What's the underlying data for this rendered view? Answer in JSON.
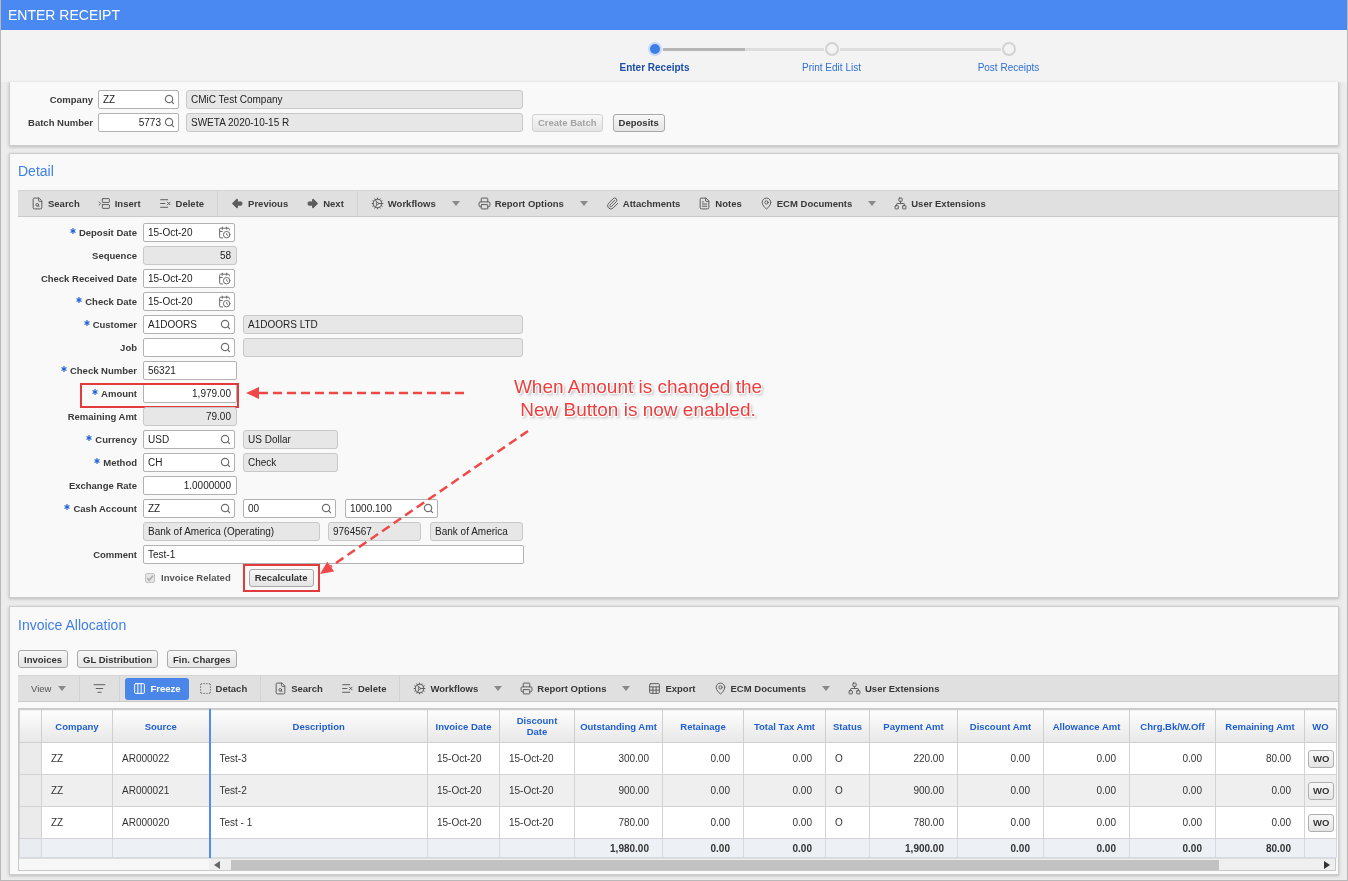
{
  "window": {
    "title": "ENTER RECEIPT"
  },
  "steps": [
    {
      "label": "Enter Receipts",
      "selected": true
    },
    {
      "label": "Print Edit List",
      "selected": false
    },
    {
      "label": "Post Receipts",
      "selected": false
    }
  ],
  "header": {
    "fields": [
      {
        "label": "Company",
        "kind": "code",
        "value": "ZZ",
        "description": "CMiC Test Company"
      },
      {
        "label": "Batch Number",
        "kind": "number",
        "value": "5773",
        "description": "SWETA 2020-10-15 R"
      }
    ],
    "buttons": [
      {
        "label": "Create Batch",
        "disabled": true
      },
      {
        "label": "Deposits",
        "disabled": false
      }
    ]
  },
  "detail": {
    "title": "Detail",
    "toolbar": [
      [
        {
          "label": "Search",
          "dropdown": false
        },
        {
          "label": "Insert",
          "dropdown": false
        },
        {
          "label": "Delete",
          "dropdown": false
        }
      ],
      [
        {
          "label": "Previous",
          "dropdown": false
        },
        {
          "label": "Next",
          "dropdown": false
        }
      ],
      [
        {
          "label": "Workflows",
          "dropdown": true
        },
        {
          "label": "Report Options",
          "dropdown": true
        },
        {
          "label": "Attachments",
          "dropdown": false
        },
        {
          "label": "Notes",
          "dropdown": false
        },
        {
          "label": "ECM Documents",
          "dropdown": true
        },
        {
          "label": "User Extensions",
          "dropdown": false
        }
      ]
    ],
    "fields": [
      {
        "label": "Deposit Date",
        "kind": "date",
        "required": true,
        "highlighted": false,
        "value": "15-Oct-20"
      },
      {
        "label": "Sequence",
        "kind": "display",
        "required": false,
        "highlighted": false,
        "value": "58"
      },
      {
        "label": "Check Received Date",
        "kind": "date",
        "required": false,
        "highlighted": false,
        "value": "15-Oct-20"
      },
      {
        "label": "Check Date",
        "kind": "date",
        "required": true,
        "highlighted": false,
        "value": "15-Oct-20"
      },
      {
        "label": "Customer",
        "kind": "lookup",
        "required": true,
        "highlighted": false,
        "value": "A1DOORS",
        "description": "A1DOORS LTD"
      },
      {
        "label": "Job",
        "kind": "lookup",
        "required": false,
        "highlighted": false
      },
      {
        "label": "Check Number",
        "kind": "text",
        "required": true,
        "highlighted": false,
        "value": "56321"
      },
      {
        "label": "Amount",
        "kind": "number",
        "required": true,
        "highlighted": true,
        "value": "1,979.00"
      },
      {
        "label": "Remaining Amt",
        "kind": "display",
        "required": false,
        "highlighted": false,
        "value": "79.00"
      },
      {
        "label": "Currency",
        "kind": "code_lookup",
        "required": true,
        "highlighted": false,
        "value": "USD",
        "description": "US Dollar"
      },
      {
        "label": "Method",
        "kind": "code_lookup",
        "required": true,
        "highlighted": false,
        "value": "CH",
        "description": "Check"
      },
      {
        "label": "Exchange Rate",
        "kind": "number",
        "required": false,
        "highlighted": false,
        "value": "1.0000000"
      },
      {
        "label": "Cash Account",
        "kind": "account",
        "required": true,
        "highlighted": false,
        "segments": [
          "ZZ",
          "00",
          "1000.100"
        ]
      },
      {
        "kind": "details",
        "required": false,
        "highlighted": false,
        "values": [
          "Bank of America (Operating)",
          "9764567",
          "Bank of America"
        ]
      },
      {
        "label": "Comment",
        "kind": "note",
        "required": false,
        "highlighted": false,
        "value": "Test-1"
      },
      {
        "label": "Invoice Related",
        "kind": "checkbox",
        "required": false,
        "highlighted": true,
        "checked": true,
        "disabled": true,
        "button": "Recalculate"
      }
    ]
  },
  "annotation": {
    "text": "When Amount is changed the New Button is now enabled."
  },
  "invoice_allocation": {
    "title": "Invoice Allocation",
    "buttons": [
      "Invoices",
      "GL Distribution",
      "Fin. Charges"
    ],
    "toolbar": [
      [
        {
          "kind": "menu",
          "label": "View",
          "dropdown": true,
          "selected": false
        }
      ],
      [
        {
          "kind": "icon",
          "dropdown": false,
          "selected": false
        }
      ],
      [
        {
          "kind": "button",
          "label": "Freeze",
          "dropdown": false,
          "selected": true
        },
        {
          "kind": "button",
          "label": "Detach",
          "dropdown": false,
          "selected": false
        }
      ],
      [
        {
          "kind": "button",
          "label": "Search",
          "dropdown": false,
          "selected": false
        },
        {
          "kind": "button",
          "label": "Delete",
          "dropdown": false,
          "selected": false
        }
      ],
      [
        {
          "kind": "button",
          "label": "Workflows",
          "dropdown": true,
          "selected": false
        },
        {
          "kind": "button",
          "label": "Report Options",
          "dropdown": true,
          "selected": false
        },
        {
          "kind": "button",
          "label": "Export",
          "dropdown": false,
          "selected": false
        },
        {
          "kind": "button",
          "label": "ECM Documents",
          "dropdown": true,
          "selected": false
        },
        {
          "kind": "button",
          "label": "User Extensions",
          "dropdown": false,
          "selected": false
        }
      ]
    ],
    "table": {
      "columns": [
        {
          "label": "Company",
          "kind": "text"
        },
        {
          "label": "Source",
          "kind": "text"
        },
        {
          "label": "Description",
          "kind": "text"
        },
        {
          "label": "Invoice Date",
          "kind": "text"
        },
        {
          "label": "Discount Date",
          "kind": "text"
        },
        {
          "label": "Outstanding Amt",
          "kind": "amount"
        },
        {
          "label": "Retainage",
          "kind": "amount"
        },
        {
          "label": "Total Tax Amt",
          "kind": "amount"
        },
        {
          "label": "Status",
          "kind": "text"
        },
        {
          "label": "Payment Amt",
          "kind": "amount"
        },
        {
          "label": "Discount Amt",
          "kind": "amount"
        },
        {
          "label": "Allowance Amt",
          "kind": "amount"
        },
        {
          "label": "Chrg.Bk/W.Off",
          "kind": "amount"
        },
        {
          "label": "Remaining Amt",
          "kind": "amount"
        },
        {
          "label": "WO",
          "kind": "button"
        }
      ],
      "rows": [
        {
          "kind": "invoice",
          "cells": [
            "ZZ",
            "AR000022",
            "Test-3",
            "15-Oct-20",
            "15-Oct-20",
            "300.00",
            "0.00",
            "0.00",
            "O",
            "220.00",
            "0.00",
            "0.00",
            "0.00",
            "80.00",
            "WO"
          ]
        },
        {
          "kind": "invoice",
          "cells": [
            "ZZ",
            "AR000021",
            "Test-2",
            "15-Oct-20",
            "15-Oct-20",
            "900.00",
            "0.00",
            "0.00",
            "O",
            "900.00",
            "0.00",
            "0.00",
            "0.00",
            "0.00",
            "WO"
          ]
        },
        {
          "kind": "invoice",
          "cells": [
            "ZZ",
            "AR000020",
            "Test - 1",
            "15-Oct-20",
            "15-Oct-20",
            "780.00",
            "0.00",
            "0.00",
            "O",
            "780.00",
            "0.00",
            "0.00",
            "0.00",
            "0.00",
            "WO"
          ]
        },
        {
          "kind": "total",
          "cells": [
            null,
            null,
            null,
            null,
            null,
            "1,980.00",
            "0.00",
            "0.00",
            null,
            "1,900.00",
            "0.00",
            "0.00",
            "0.00",
            "80.00",
            null
          ]
        }
      ]
    }
  }
}
